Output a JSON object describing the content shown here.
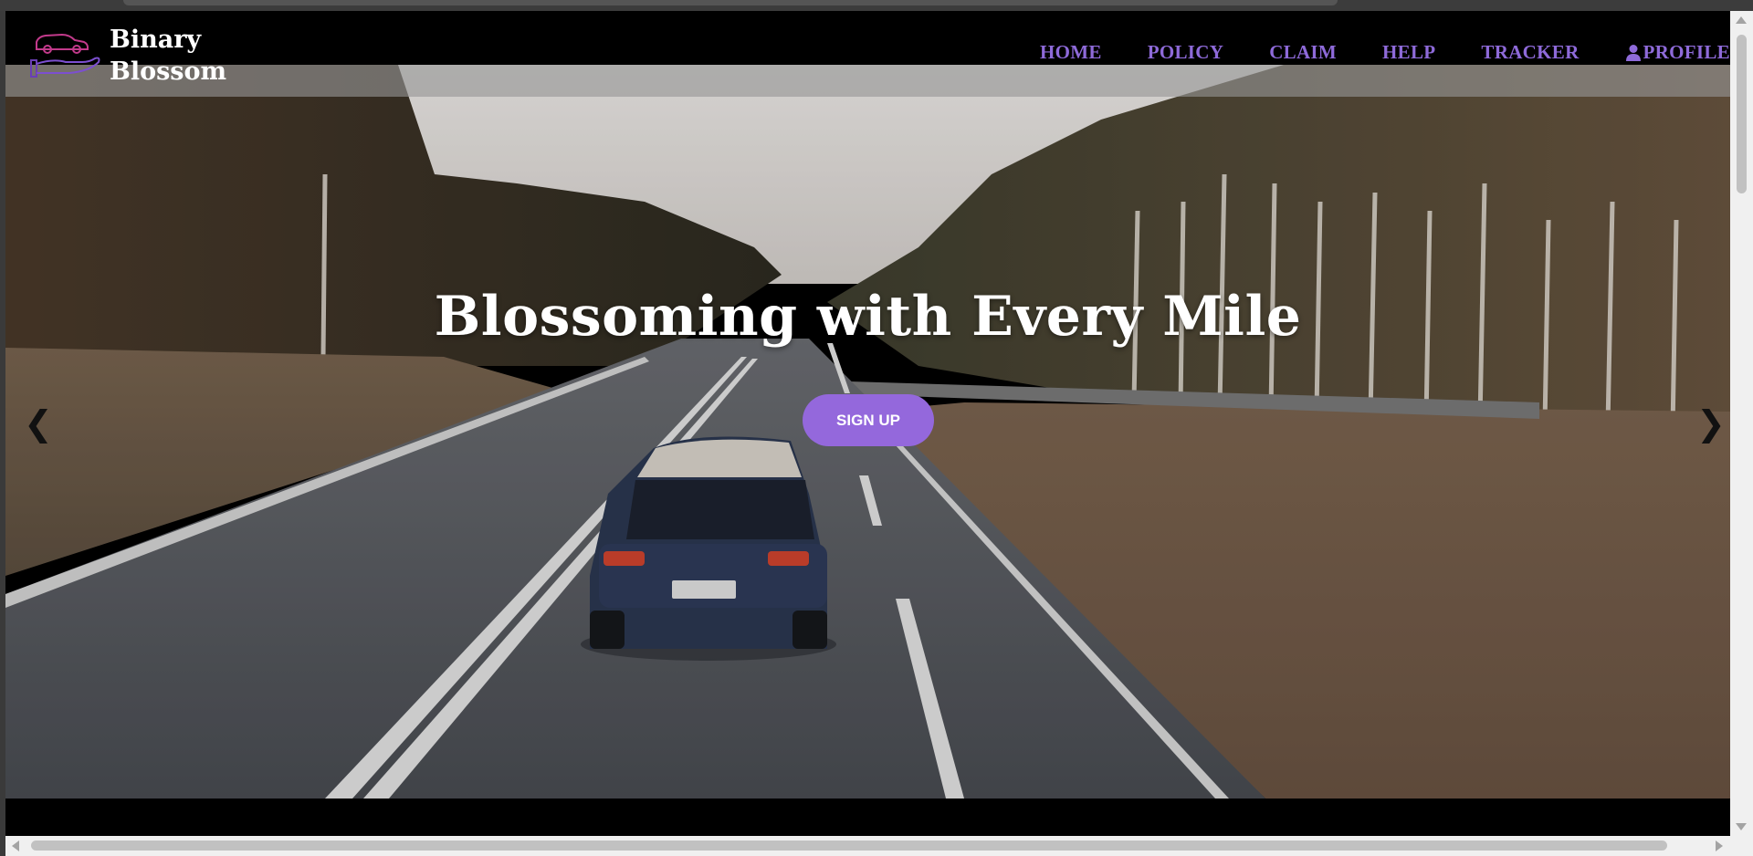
{
  "brand": {
    "name": "Binary\nBlossom",
    "logo_icon": "car-in-hand-icon"
  },
  "nav": {
    "items": [
      {
        "label": "HOME"
      },
      {
        "label": "POLICY"
      },
      {
        "label": "CLAIM"
      },
      {
        "label": "HELP"
      },
      {
        "label": "TRACKER"
      },
      {
        "label": "PROFILE",
        "icon": "person-icon"
      }
    ],
    "color": "#8e6ad9"
  },
  "hero": {
    "title": "Blossoming with Every Mile",
    "cta_label": "SIGN UP",
    "cta_color": "#9468dc",
    "prev_label": "❮",
    "next_label": "❯",
    "background": "road-with-car-image"
  }
}
